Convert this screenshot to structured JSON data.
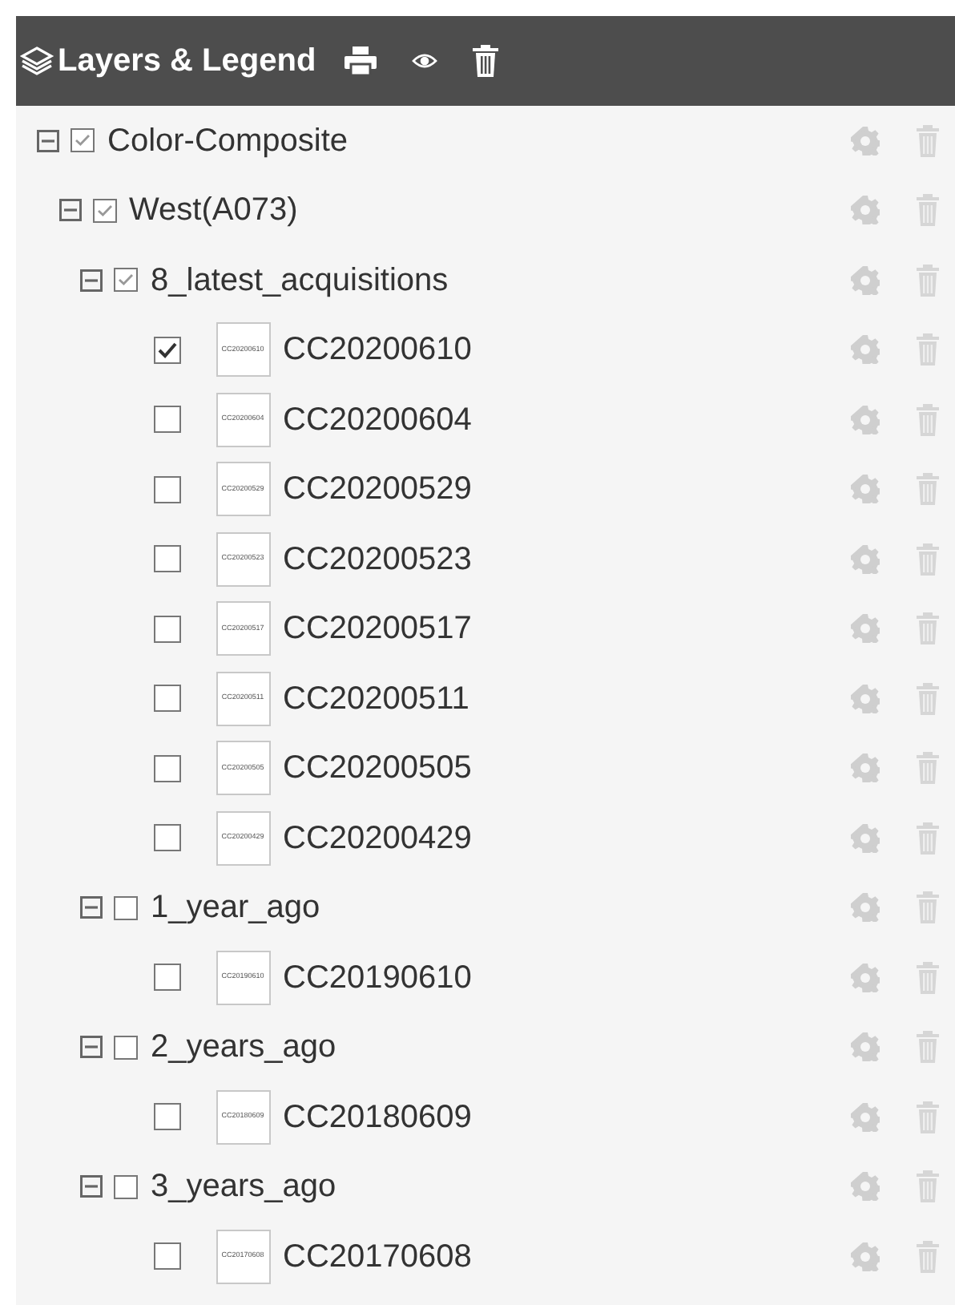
{
  "header": {
    "title": "Layers & Legend"
  },
  "tree": [
    {
      "kind": "group",
      "name": "Color-Composite",
      "checked": true,
      "expanded": true,
      "children": [
        {
          "kind": "group",
          "name": "West(A073)",
          "checked": true,
          "expanded": true,
          "children": [
            {
              "kind": "group",
              "name": "8_latest_acquisitions",
              "checked": true,
              "expanded": true,
              "children": [
                {
                  "kind": "layer",
                  "name": "CC20200610",
                  "legend_text": "CC20200610",
                  "checked": true
                },
                {
                  "kind": "layer",
                  "name": "CC20200604",
                  "legend_text": "CC20200604",
                  "checked": false
                },
                {
                  "kind": "layer",
                  "name": "CC20200529",
                  "legend_text": "CC20200529",
                  "checked": false
                },
                {
                  "kind": "layer",
                  "name": "CC20200523",
                  "legend_text": "CC20200523",
                  "checked": false
                },
                {
                  "kind": "layer",
                  "name": "CC20200517",
                  "legend_text": "CC20200517",
                  "checked": false
                },
                {
                  "kind": "layer",
                  "name": "CC20200511",
                  "legend_text": "CC20200511",
                  "checked": false
                },
                {
                  "kind": "layer",
                  "name": "CC20200505",
                  "legend_text": "CC20200505",
                  "checked": false
                },
                {
                  "kind": "layer",
                  "name": "CC20200429",
                  "legend_text": "CC20200429",
                  "checked": false
                }
              ]
            },
            {
              "kind": "group",
              "name": "1_year_ago",
              "checked": false,
              "expanded": true,
              "children": [
                {
                  "kind": "layer",
                  "name": "CC20190610",
                  "legend_text": "CC20190610",
                  "checked": false
                }
              ]
            },
            {
              "kind": "group",
              "name": "2_years_ago",
              "checked": false,
              "expanded": true,
              "children": [
                {
                  "kind": "layer",
                  "name": "CC20180609",
                  "legend_text": "CC20180609",
                  "checked": false
                }
              ]
            },
            {
              "kind": "group",
              "name": "3_years_ago",
              "checked": false,
              "expanded": true,
              "children": [
                {
                  "kind": "layer",
                  "name": "CC20170608",
                  "legend_text": "CC20170608",
                  "checked": false
                }
              ]
            }
          ]
        }
      ]
    }
  ]
}
